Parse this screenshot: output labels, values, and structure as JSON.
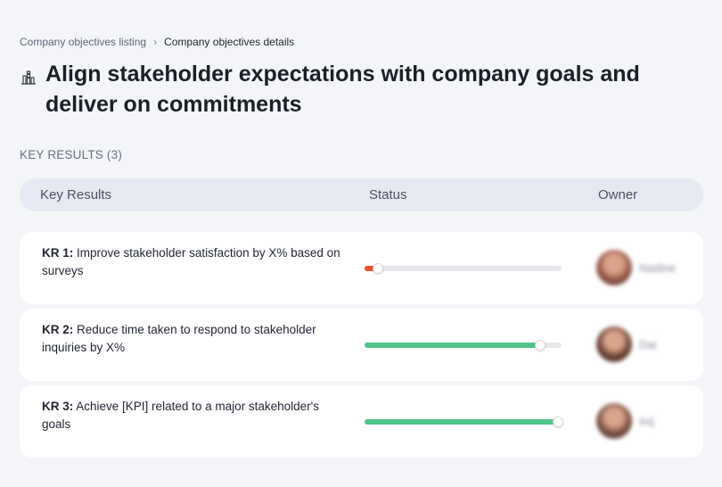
{
  "breadcrumb": {
    "parent": "Company objectives listing",
    "separator": "›",
    "current": "Company objectives details"
  },
  "page": {
    "title_icon": "building-chart-icon",
    "title": "Align stakeholder expectations with company goals and deliver on commitments"
  },
  "section": {
    "label": "KEY RESULTS (3)"
  },
  "table": {
    "columns": {
      "key_results": "Key Results",
      "status": "Status",
      "owner": "Owner"
    }
  },
  "key_results": [
    {
      "code": "KR 1:",
      "text": " Improve stakeholder satisfaction by X% based on surveys",
      "progress": 0.07,
      "progress_color": "#f0532d",
      "owner": "Nadine",
      "avatar_color": "#9a5a4a"
    },
    {
      "code": "KR 2:",
      "text": " Reduce time taken to respond to stakeholder inquiries by X%",
      "progress": 0.89,
      "progress_color": "#4fc487",
      "owner": "Dai",
      "avatar_color": "#6e4636"
    },
    {
      "code": "KR 3:",
      "text": " Achieve [KPI] related to a major stakeholder's goals",
      "progress": 0.98,
      "progress_color": "#4fc487",
      "owner": "Inij",
      "avatar_color": "#7d5444"
    }
  ]
}
